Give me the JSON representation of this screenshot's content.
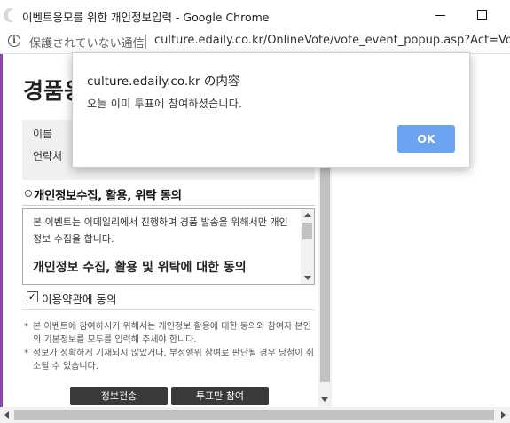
{
  "window": {
    "title": "이벤트응모를 위한 개인정보입력 - Google Chrome"
  },
  "address_bar": {
    "security_text": "保護されていない通信",
    "url": "culture.edaily.co.kr/OnlineVote/vote_event_popup.asp?Act=Vo..."
  },
  "page": {
    "heading_partial": "경품응",
    "form": {
      "name_label": "이름",
      "phone_label": "연락처"
    },
    "section_title": "개인정보수집, 활용, 위탁 동의",
    "terms": {
      "intro": "본 이벤트는 이데일리에서 진행하며 경품 발송을 위해서만 개인정보 수집을 합니다.",
      "subtitle": "개인정보 수집, 활용 및 위탁에 대한 동의"
    },
    "agree": {
      "label": "이용약관에 동의",
      "checked": true
    },
    "notes": [
      "본 이벤트에 참여하시기 위해서는 개인정보 활용에 대한 동의와 참여자 본인의 기본정보를 모두를 입력해 주세야 합니다.",
      "정보가 정확하게 기재되지 않았거나, 부정행위 참여로 판단될 경우 당첨이 취소될 수 있습니다."
    ],
    "buttons": {
      "submit": "정보전송",
      "vote_only": "투표만 참여"
    }
  },
  "dialog": {
    "title": "culture.edaily.co.kr の内容",
    "message": "오늘 이미 투표에 참여하셨습니다.",
    "ok": "OK"
  },
  "colors": {
    "accent_purple": "#8e44ad",
    "ok_button": "#6ba3f1",
    "dark_button": "#3a3a3a"
  },
  "icons": [
    "chrome-icon",
    "minimize-icon",
    "maximize-icon",
    "info-icon",
    "checkbox-checked-icon"
  ]
}
